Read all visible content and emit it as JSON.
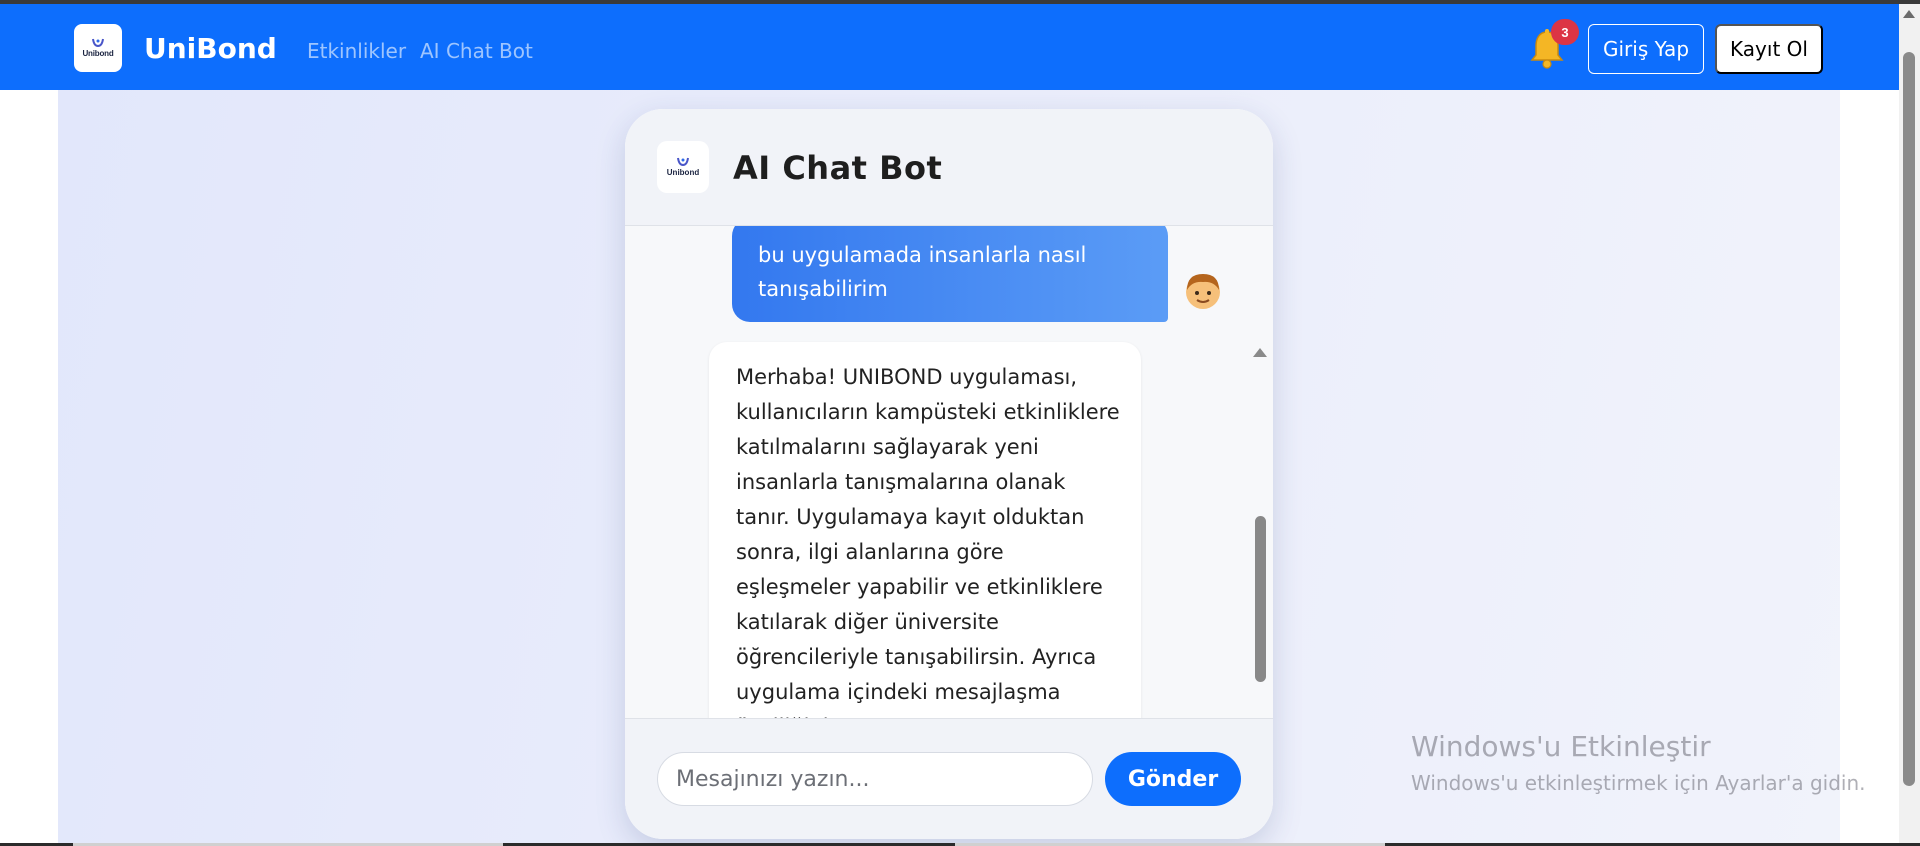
{
  "navbar": {
    "brand_logo_text": "Unibond",
    "brand_name": "UniBond",
    "links": [
      "Etkinlikler",
      "AI Chat Bot"
    ],
    "notification_count": "3",
    "login_label": "Giriş Yap",
    "register_label": "Kayıt Ol",
    "color": "#0d6efd"
  },
  "chat": {
    "logo_text": "Unibond",
    "title": "AI Chat Bot",
    "messages": [
      {
        "role": "user",
        "text": "bu uygulamada insanlarla nasıl tanışabilirim",
        "avatar_icon": "boy-face-icon"
      },
      {
        "role": "bot",
        "text": "Merhaba! UNIBOND uygulaması, kullanıcıların kampüsteki etkinliklere katılmalarını sağlayarak yeni insanlarla tanışmalarına olanak tanır. Uygulamaya kayıt olduktan sonra, ilgi alanlarına göre eşleşmeler yapabilir ve etkinliklere katılarak diğer üniversite öğrencileriyle tanışabilirsin. Ayrıca uygulama içindeki mesajlaşma özelliğini"
      }
    ],
    "input_placeholder": "Mesajınızı yazın...",
    "input_value": "",
    "send_label": "Gönder"
  },
  "watermark": {
    "title": "Windows'u Etkinleştir",
    "subtitle": "Windows'u etkinleştirmek için Ayarlar'a gidin."
  }
}
